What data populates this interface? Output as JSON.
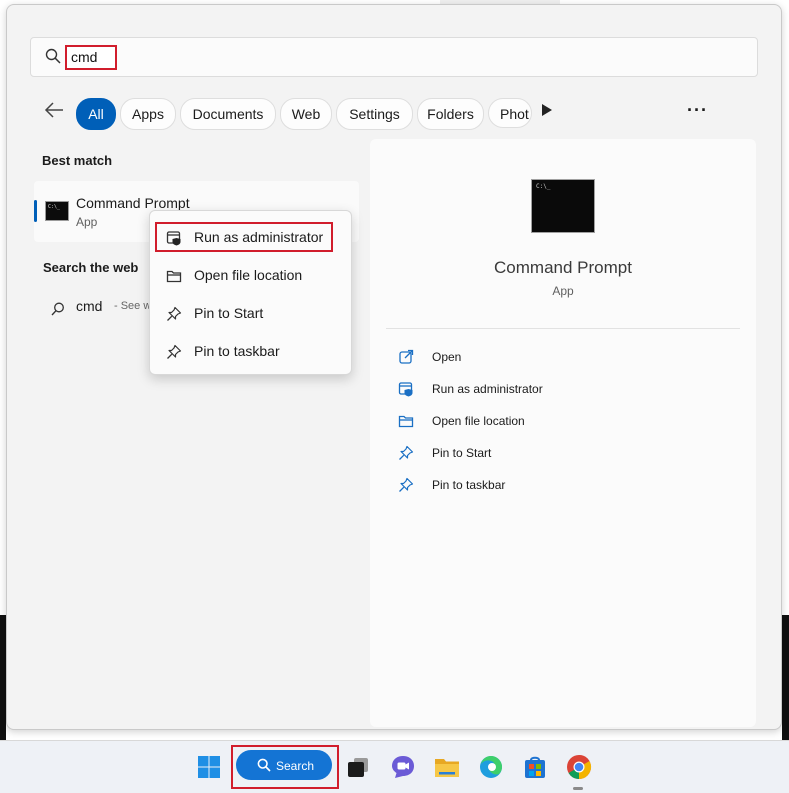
{
  "search": {
    "query": "cmd"
  },
  "filters": [
    {
      "label": "All",
      "active": true
    },
    {
      "label": "Apps"
    },
    {
      "label": "Documents"
    },
    {
      "label": "Web"
    },
    {
      "label": "Settings"
    },
    {
      "label": "Folders"
    },
    {
      "label": "Phot"
    }
  ],
  "more_menu": "···",
  "best_match": {
    "heading": "Best match",
    "title": "Command Prompt",
    "subtitle": "App"
  },
  "search_web": {
    "heading": "Search the web",
    "query": "cmd",
    "hint": "- See we"
  },
  "context_menu": [
    {
      "label": "Run as administrator",
      "icon": "admin-shield-icon"
    },
    {
      "label": "Open file location",
      "icon": "folder-icon"
    },
    {
      "label": "Pin to Start",
      "icon": "pin-icon"
    },
    {
      "label": "Pin to taskbar",
      "icon": "pin-icon"
    }
  ],
  "detail": {
    "title": "Command Prompt",
    "subtitle": "App",
    "actions": [
      {
        "label": "Open",
        "icon": "open-external-icon"
      },
      {
        "label": "Run as administrator",
        "icon": "admin-shield-icon"
      },
      {
        "label": "Open file location",
        "icon": "folder-icon"
      },
      {
        "label": "Pin to Start",
        "icon": "pin-icon"
      },
      {
        "label": "Pin to taskbar",
        "icon": "pin-icon"
      }
    ]
  },
  "taskbar": {
    "search_label": "Search",
    "icons": [
      "windows-start-icon",
      "task-view-icon",
      "chat-icon",
      "file-explorer-icon",
      "edge-icon",
      "store-icon",
      "chrome-icon"
    ]
  },
  "colors": {
    "accent": "#005fb8",
    "highlight_red": "#d11d2c",
    "taskbar_search": "#1474d4"
  }
}
